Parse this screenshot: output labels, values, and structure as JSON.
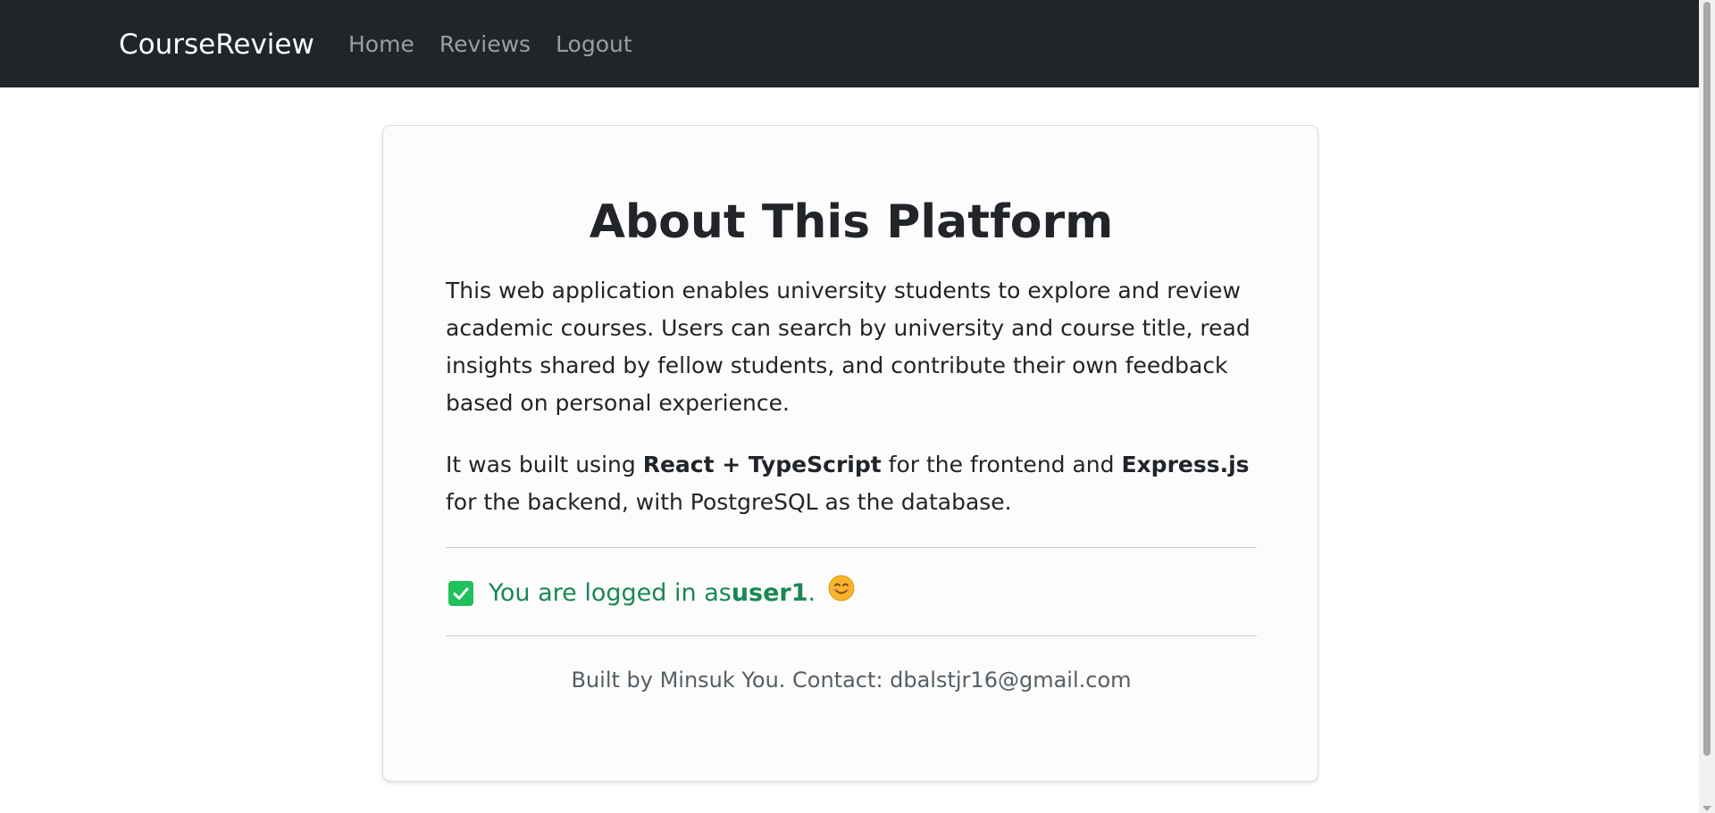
{
  "navbar": {
    "brand": "CourseReview",
    "links": [
      {
        "label": "Home"
      },
      {
        "label": "Reviews"
      },
      {
        "label": "Logout"
      }
    ]
  },
  "about": {
    "title": "About This Platform",
    "paragraph1": "This web application enables university students to explore and review academic courses. Users can search by university and course title, read insights shared by fellow students, and contribute their own feedback based on personal experience.",
    "paragraph2": {
      "prefix": "It was built using ",
      "frontend_tech": "React + TypeScript",
      "middle": " for the frontend and ",
      "backend_tech": "Express.js",
      "suffix": " for the backend, with PostgreSQL as the database."
    },
    "status": {
      "prefix": "You are logged in as ",
      "username": "user1",
      "suffix": ".",
      "icon": "check-box-icon",
      "emoji_icon": "smiling-face-icon",
      "color": "#198754"
    },
    "footer": "Built by Minsuk You. Contact: dbalstjr16@gmail.com"
  },
  "colors": {
    "navbar_bg": "#212529",
    "check_green": "#20c05c"
  }
}
